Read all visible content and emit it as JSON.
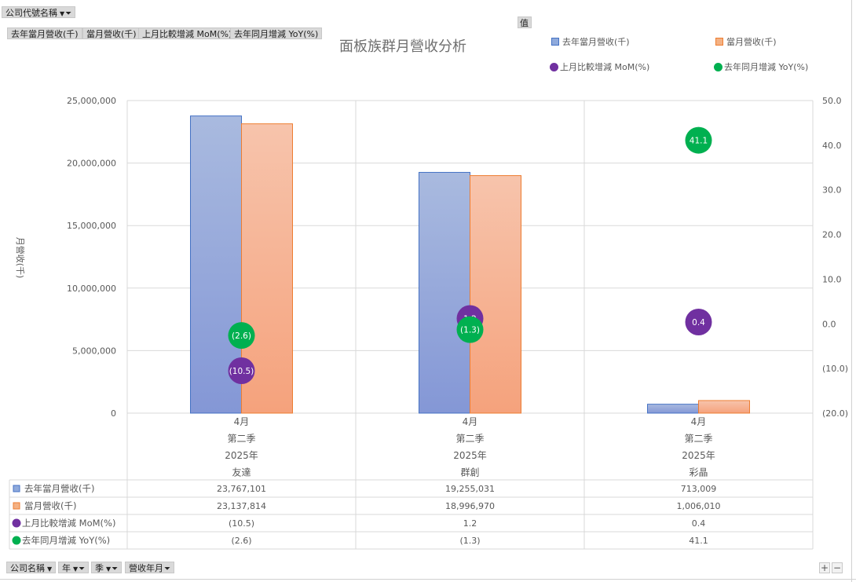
{
  "filters_top": {
    "company_name": "公司代號名稱",
    "values_button": "值"
  },
  "value_buttons": [
    "去年當月營收(千)",
    "當月營收(千)",
    "上月比較增減 MoM(%)",
    "去年同月增減 YoY(%)"
  ],
  "filters_bottom": [
    "公司名稱",
    "年",
    "季",
    "營收年月"
  ],
  "zoom": {
    "plus": "+",
    "minus": "−"
  },
  "colors": {
    "bar_last_year": "#8faadc",
    "bar_current": "#f4b183",
    "dot_mom": "#7030a0",
    "dot_yoy": "#00b050"
  },
  "chart_data": {
    "type": "bar",
    "title": "面板族群月營收分析",
    "ylabel": "月營收(千)",
    "ylim": [
      0,
      25000000
    ],
    "y_ticks": [
      "25,000,000",
      "20,000,000",
      "15,000,000",
      "10,000,000",
      "5,000,000",
      "0"
    ],
    "y2lim": [
      -20,
      50
    ],
    "y2_ticks": [
      "50.0",
      "40.0",
      "30.0",
      "20.0",
      "10.0",
      "0.0",
      "(10.0)",
      "(20.0)"
    ],
    "grid": true,
    "legend": "top-right",
    "categories": [
      {
        "month": "4月",
        "quarter": "第二季",
        "year": "2025年",
        "company": "友達"
      },
      {
        "month": "4月",
        "quarter": "第二季",
        "year": "2025年",
        "company": "群創"
      },
      {
        "month": "4月",
        "quarter": "第二季",
        "year": "2025年",
        "company": "彩晶"
      }
    ],
    "series": [
      {
        "name": "去年當月營收(千)",
        "type": "bar",
        "axis": "left",
        "values": [
          23767101,
          19255031,
          713009
        ],
        "labels": [
          "23,767,101",
          "19,255,031",
          "713,009"
        ]
      },
      {
        "name": "當月營收(千)",
        "type": "bar",
        "axis": "left",
        "values": [
          23137814,
          18996970,
          1006010
        ],
        "labels": [
          "23,137,814",
          "18,996,970",
          "1,006,010"
        ]
      },
      {
        "name": "上月比較增減 MoM(%)",
        "type": "scatter",
        "axis": "right",
        "values": [
          -10.5,
          1.2,
          0.4
        ],
        "labels": [
          "(10.5)",
          "1.2",
          "0.4"
        ]
      },
      {
        "name": "去年同月增減 YoY(%)",
        "type": "scatter",
        "axis": "right",
        "values": [
          -2.6,
          -1.3,
          41.1
        ],
        "labels": [
          "(2.6)",
          "(1.3)",
          "41.1"
        ]
      }
    ]
  }
}
